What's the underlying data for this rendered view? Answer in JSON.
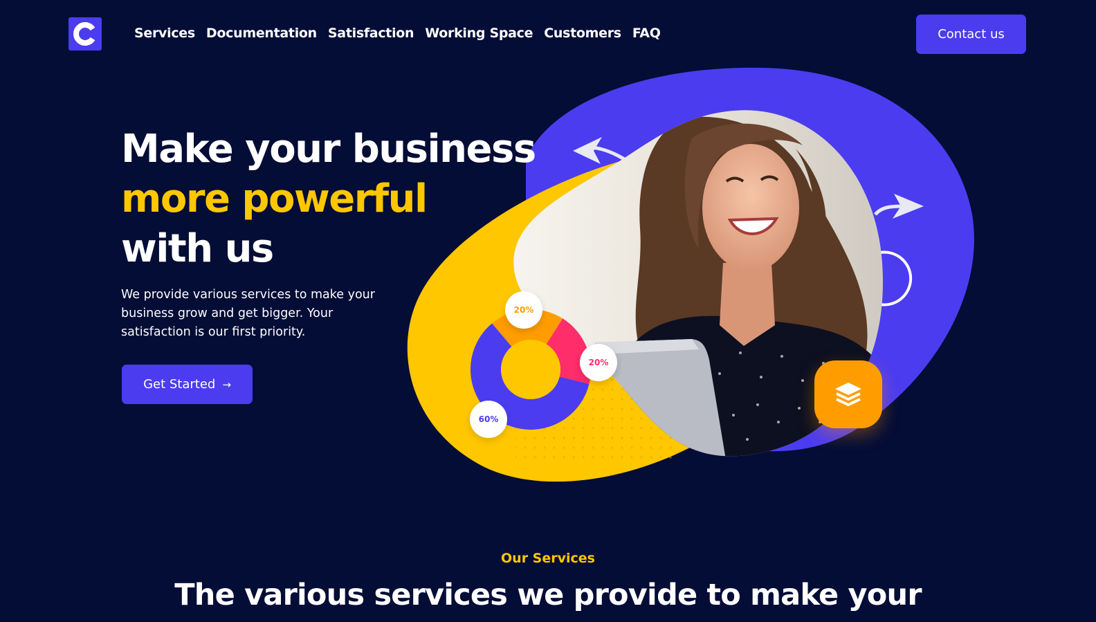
{
  "brand": {
    "logo_letter": "C",
    "accent": "#4b3cf0",
    "highlight": "#ffc700",
    "background": "#040d36"
  },
  "nav": {
    "items": [
      {
        "label": "Services"
      },
      {
        "label": "Documentation"
      },
      {
        "label": "Satisfaction"
      },
      {
        "label": "Working Space"
      },
      {
        "label": "Customers"
      },
      {
        "label": "FAQ"
      }
    ],
    "contact_label": "Contact us"
  },
  "hero": {
    "title_line1": "Make your business",
    "title_line2": "more powerful",
    "title_line3": "with us",
    "description": "We provide various services to make your business grow and get bigger. Your satisfaction is our first priority.",
    "cta_label": "Get Started",
    "cta_icon": "arrow-right-icon"
  },
  "donut": {
    "segments": [
      {
        "label": "20%",
        "value": 20,
        "color": "#ff9d00"
      },
      {
        "label": "20%",
        "value": 20,
        "color": "#ff2d6a"
      },
      {
        "label": "60%",
        "value": 60,
        "color": "#4b3cf0"
      }
    ]
  },
  "floating_icon": "layers-icon",
  "services": {
    "eyebrow": "Our Services",
    "title": "The various services we provide to make your"
  }
}
